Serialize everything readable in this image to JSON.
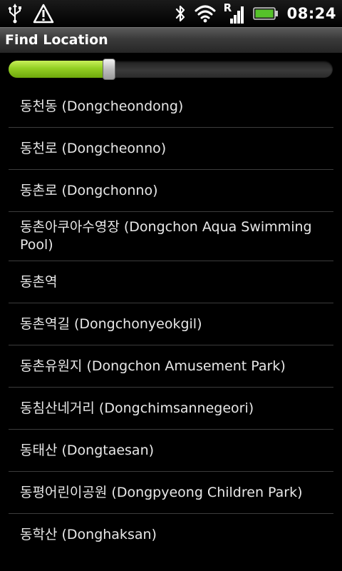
{
  "status_bar": {
    "time": "08:24",
    "icons_left": [
      "usb-icon",
      "warning-icon"
    ],
    "icons_right": [
      "bluetooth-icon",
      "wifi-icon",
      "signal-roaming-icon",
      "battery-icon"
    ],
    "roaming_indicator": "R",
    "battery_color": "#56c22a"
  },
  "title_bar": {
    "title": "Find Location"
  },
  "progress": {
    "fill_fraction": 0.31,
    "fill_color": "#93cf23"
  },
  "locations": [
    {
      "label": "동천동 (Dongcheondong)"
    },
    {
      "label": "동천로 (Dongcheonno)"
    },
    {
      "label": "동촌로 (Dongchonno)"
    },
    {
      "label": "동촌아쿠아수영장 (Dongchon Aqua Swimming Pool)"
    },
    {
      "label": "동촌역"
    },
    {
      "label": "동촌역길 (Dongchonyeokgil)"
    },
    {
      "label": "동촌유원지 (Dongchon Amusement Park)"
    },
    {
      "label": "동침산네거리 (Dongchimsannegeori)"
    },
    {
      "label": "동태산 (Dongtaesan)"
    },
    {
      "label": "동평어린이공원 (Dongpyeong Children Park)"
    },
    {
      "label": "동학산 (Donghaksan)"
    }
  ]
}
